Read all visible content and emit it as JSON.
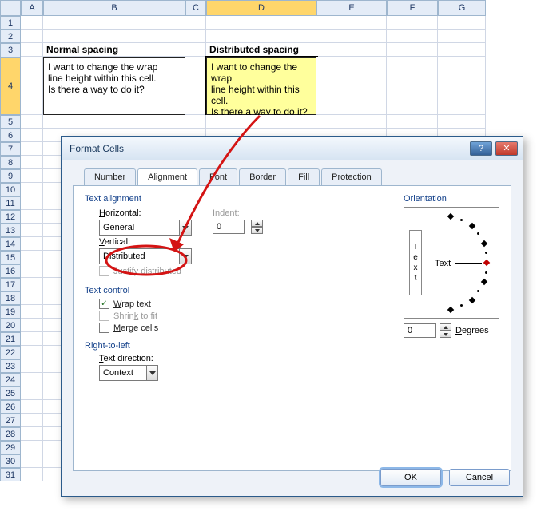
{
  "columns": [
    "A",
    "B",
    "C",
    "D",
    "E",
    "F",
    "G"
  ],
  "headers": {
    "B": "Normal spacing",
    "D": "Distributed spacing"
  },
  "sampleText": {
    "line1": "I want to change the wrap",
    "line2": "line height within this cell.",
    "line3": "Is there a way to do it?"
  },
  "dialog": {
    "title": "Format Cells",
    "tabs": [
      "Number",
      "Alignment",
      "Font",
      "Border",
      "Fill",
      "Protection"
    ],
    "activeTab": "Alignment",
    "groups": {
      "textAlignment": "Text alignment",
      "textControl": "Text control",
      "rtl": "Right-to-left",
      "orientation": "Orientation"
    },
    "labels": {
      "horizontal": "Horizontal:",
      "vertical": "Vertical:",
      "indent": "Indent:",
      "justifyDistributed": "Justify distributed",
      "wrapText": "Wrap text",
      "shrinkToFit": "Shrink to fit",
      "mergeCells": "Merge cells",
      "textDirection": "Text direction:",
      "degrees": "Degrees",
      "vtext": "Text",
      "htext": "Text"
    },
    "values": {
      "horizontal": "General",
      "vertical": "Distributed",
      "indent": "0",
      "textDirection": "Context",
      "degrees": "0",
      "wrapText": true,
      "shrinkToFit": false,
      "mergeCells": false,
      "justifyDistributed": false
    },
    "buttons": {
      "ok": "OK",
      "cancel": "Cancel"
    }
  }
}
